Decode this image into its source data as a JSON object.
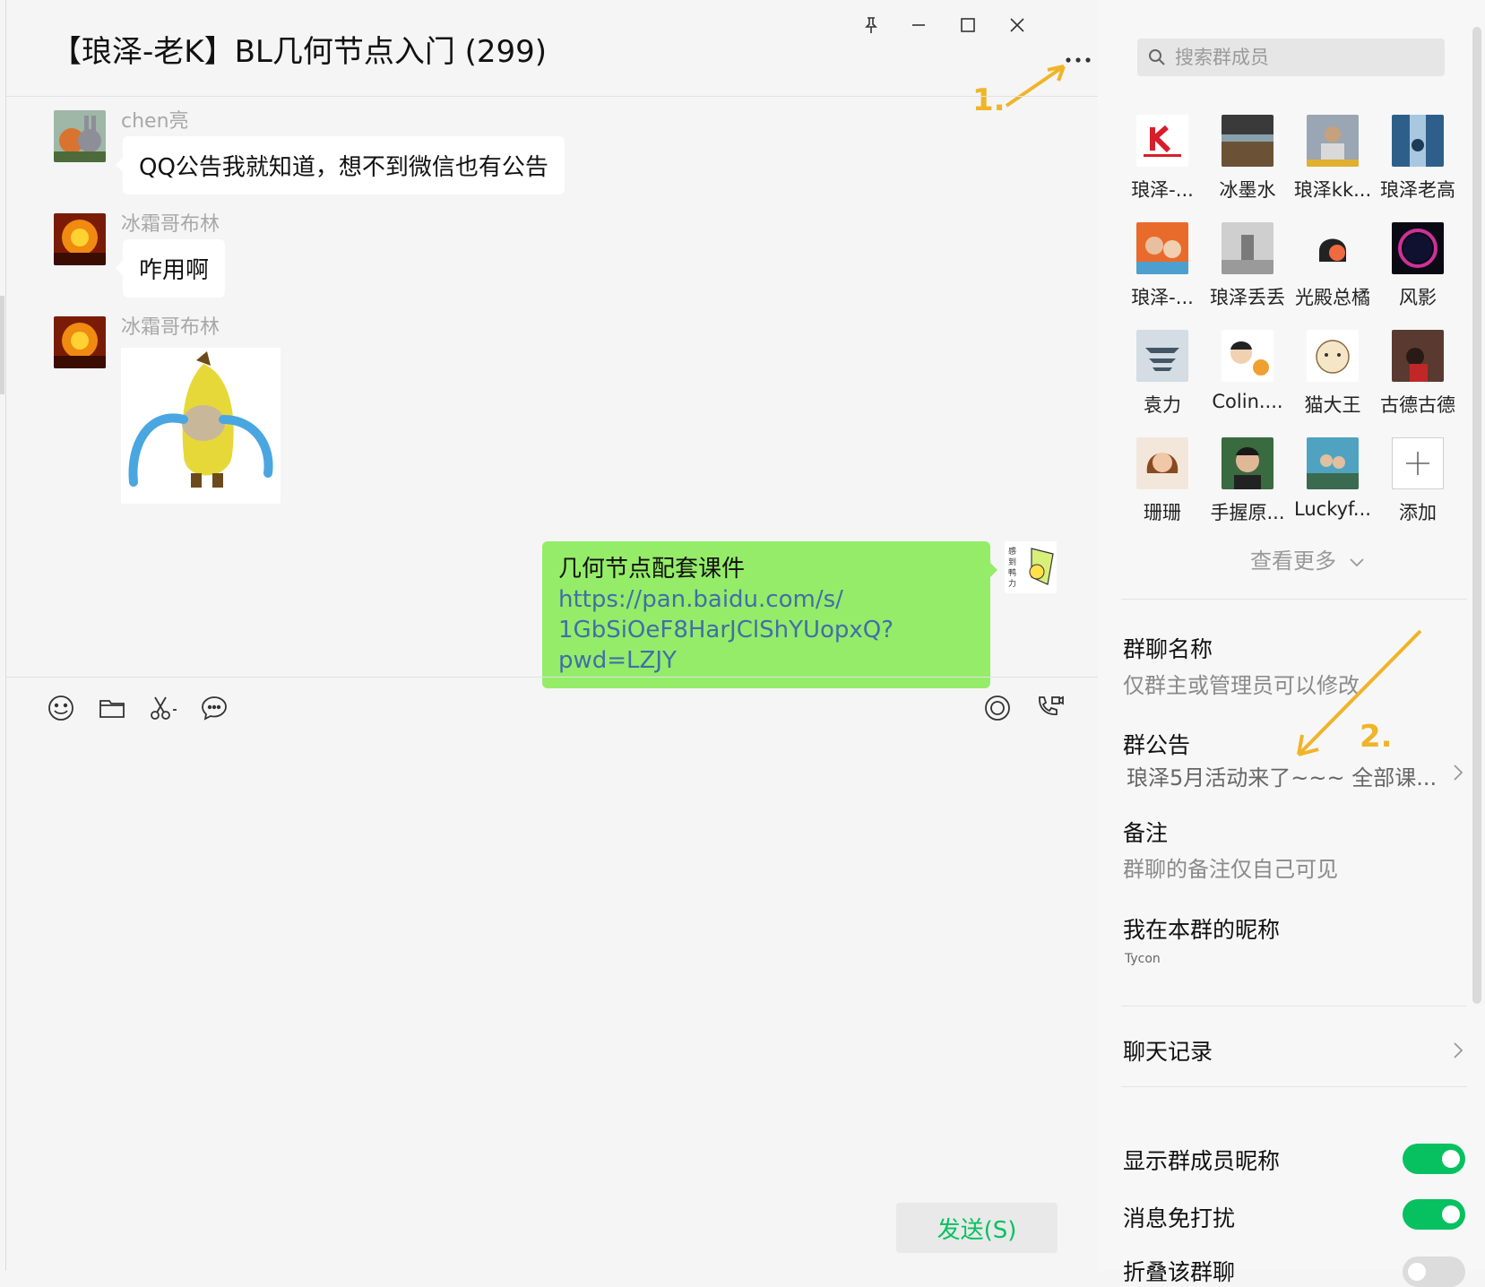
{
  "chat": {
    "title": "【琅泽-老K】BL几何节点入门 (299)",
    "messages": [
      {
        "sender": "chen亮",
        "text": "QQ公告我就知道，想不到微信也有公告"
      },
      {
        "sender": "冰霜哥布林",
        "text": "咋用啊"
      },
      {
        "sender": "冰霜哥布林",
        "text": ""
      }
    ],
    "my_message": {
      "line1": "几何节点配套课件",
      "link1": "https://pan.baidu.com/s/",
      "link2": "1GbSiOeF8HarJClShYUopxQ?pwd=LZJY"
    },
    "send_label": "发送(S)"
  },
  "annotations": {
    "one": "1.",
    "two": "2.",
    "color": "#f0b429"
  },
  "side": {
    "search_placeholder": "搜索群成员",
    "members": [
      {
        "name": "琅泽-..."
      },
      {
        "name": "冰墨水"
      },
      {
        "name": "琅泽kk..."
      },
      {
        "name": "琅泽老高"
      },
      {
        "name": "琅泽-..."
      },
      {
        "name": "琅泽丢丢"
      },
      {
        "name": "光殿总橘"
      },
      {
        "name": "风影"
      },
      {
        "name": "袁力"
      },
      {
        "name": "Colin...."
      },
      {
        "name": "猫大王"
      },
      {
        "name": "古德古德"
      },
      {
        "name": "珊珊"
      },
      {
        "name": "手握原..."
      },
      {
        "name": "Luckyf..."
      }
    ],
    "add_label": "添加",
    "see_more": "查看更多",
    "group_name_label": "群聊名称",
    "group_name_hint": "仅群主或管理员可以修改",
    "notice_label": "群公告",
    "notice_text": "琅泽5月活动来了~~~ 全部课...",
    "remark_label": "备注",
    "remark_hint": "群聊的备注仅自己可见",
    "nickname_label": "我在本群的昵称",
    "nickname_value": "Tycon",
    "history_label": "聊天记录",
    "show_nick_label": "显示群成员昵称",
    "mute_label": "消息免打扰",
    "fold_label": "折叠该群聊",
    "accent_color": "#07c160"
  }
}
